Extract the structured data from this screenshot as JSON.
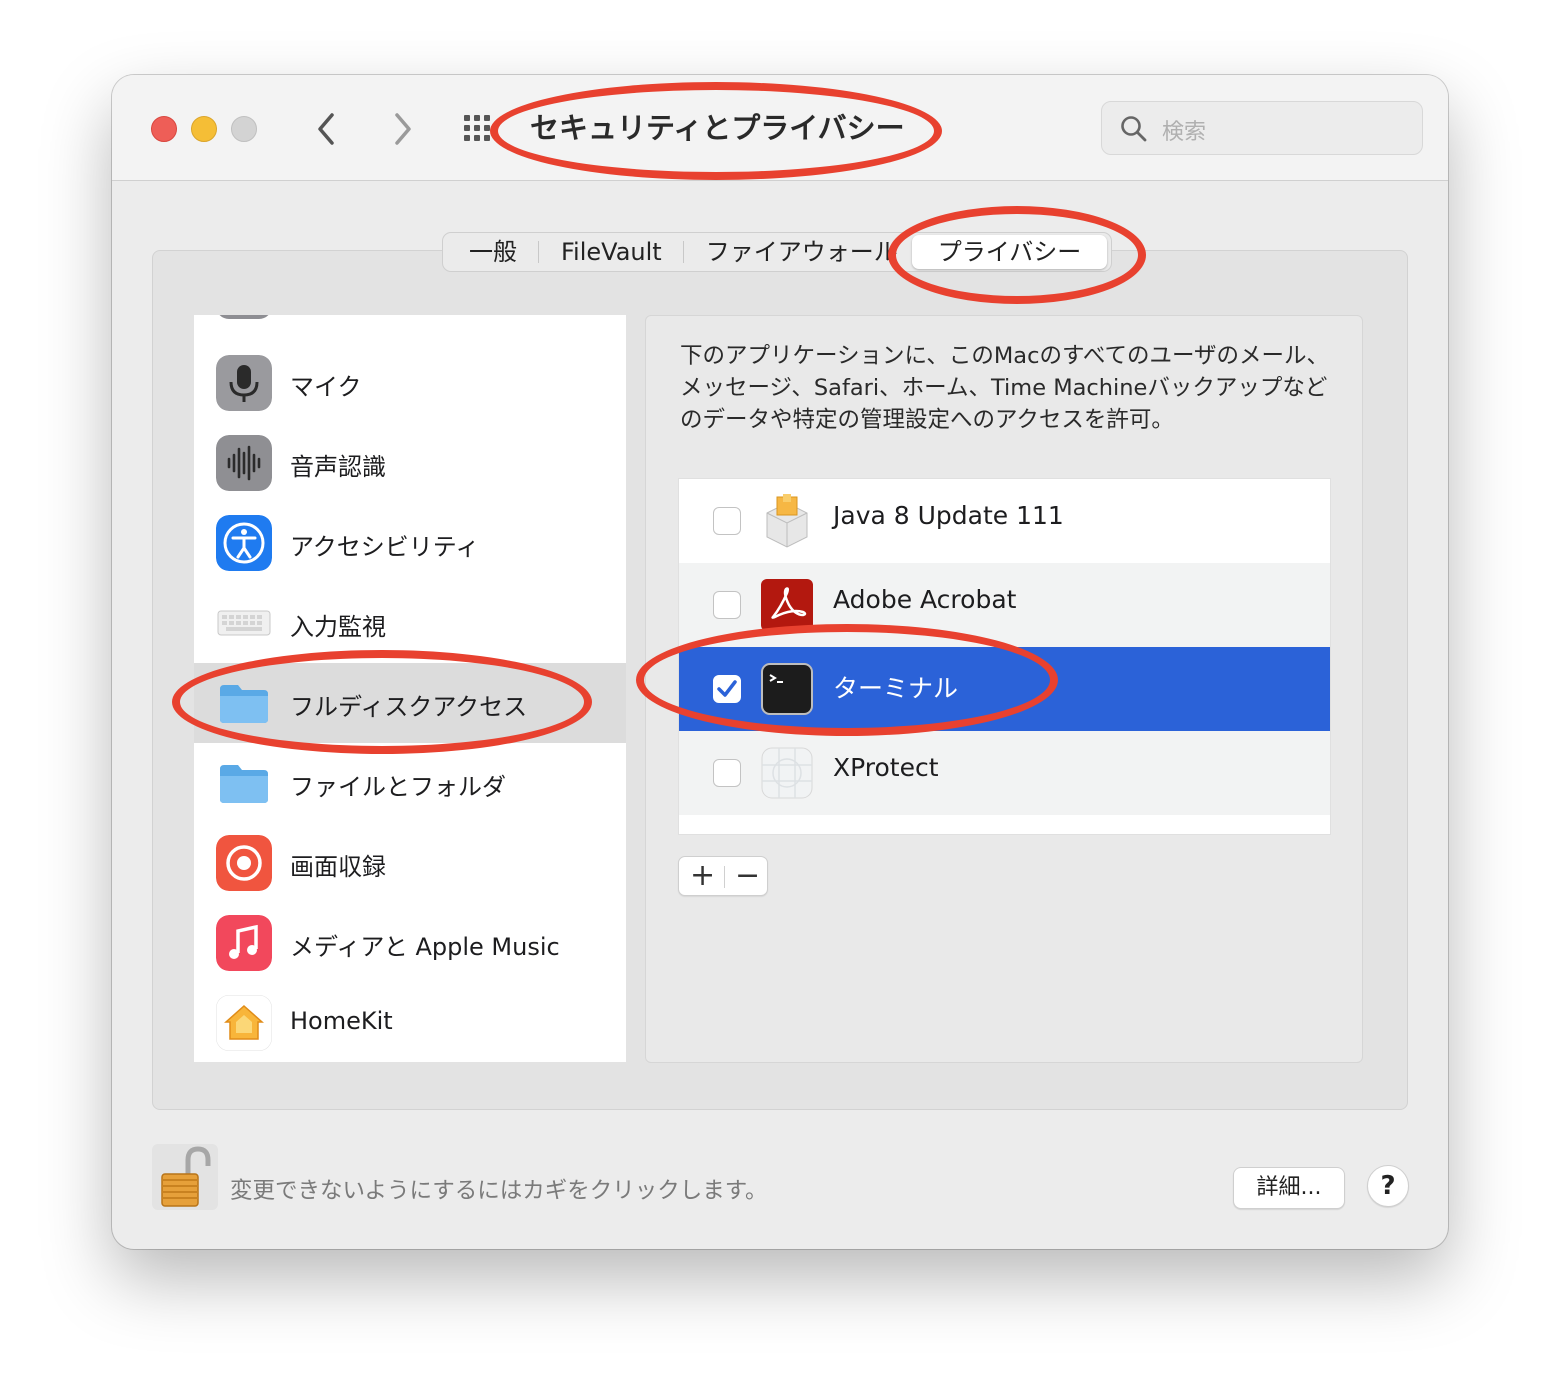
{
  "window": {
    "title": "セキュリティとプライバシー",
    "search_placeholder": "検索"
  },
  "tabs": [
    {
      "label": "一般"
    },
    {
      "label": "FileVault"
    },
    {
      "label": "ファイアウォール"
    },
    {
      "label": "プライバシー",
      "active": true
    }
  ],
  "sidebar": {
    "items": [
      {
        "label": "マイク",
        "icon": "microphone-icon"
      },
      {
        "label": "音声認識",
        "icon": "waveform-icon"
      },
      {
        "label": "アクセシビリティ",
        "icon": "accessibility-icon"
      },
      {
        "label": "入力監視",
        "icon": "keyboard-icon"
      },
      {
        "label": "フルディスクアクセス",
        "icon": "folder-icon",
        "selected": true
      },
      {
        "label": "ファイルとフォルダ",
        "icon": "folder-icon"
      },
      {
        "label": "画面収録",
        "icon": "screen-record-icon"
      },
      {
        "label": "メディアと Apple Music",
        "icon": "music-icon"
      },
      {
        "label": "HomeKit",
        "icon": "home-icon"
      }
    ]
  },
  "main": {
    "description": "下のアプリケーションに、このMacのすべてのユーザのメール、メッセージ、Safari、ホーム、Time Machineバックアップなどのデータや特定の管理設定へのアクセスを許可。",
    "apps": [
      {
        "name": "Java 8 Update 111",
        "checked": false,
        "icon": "java-installer-icon"
      },
      {
        "name": "Adobe Acrobat",
        "checked": false,
        "icon": "adobe-acrobat-icon"
      },
      {
        "name": "ターミナル",
        "checked": true,
        "selected": true,
        "icon": "terminal-icon"
      },
      {
        "name": "XProtect",
        "checked": false,
        "icon": "xprotect-icon"
      }
    ],
    "add_label": "+",
    "remove_label": "−"
  },
  "footer": {
    "lock_text": "変更できないようにするにはカギをクリックします。",
    "advanced_label": "詳細...",
    "help_label": "?"
  },
  "colors": {
    "selection_blue": "#2b62d8",
    "annotation_red": "#e8412f"
  }
}
